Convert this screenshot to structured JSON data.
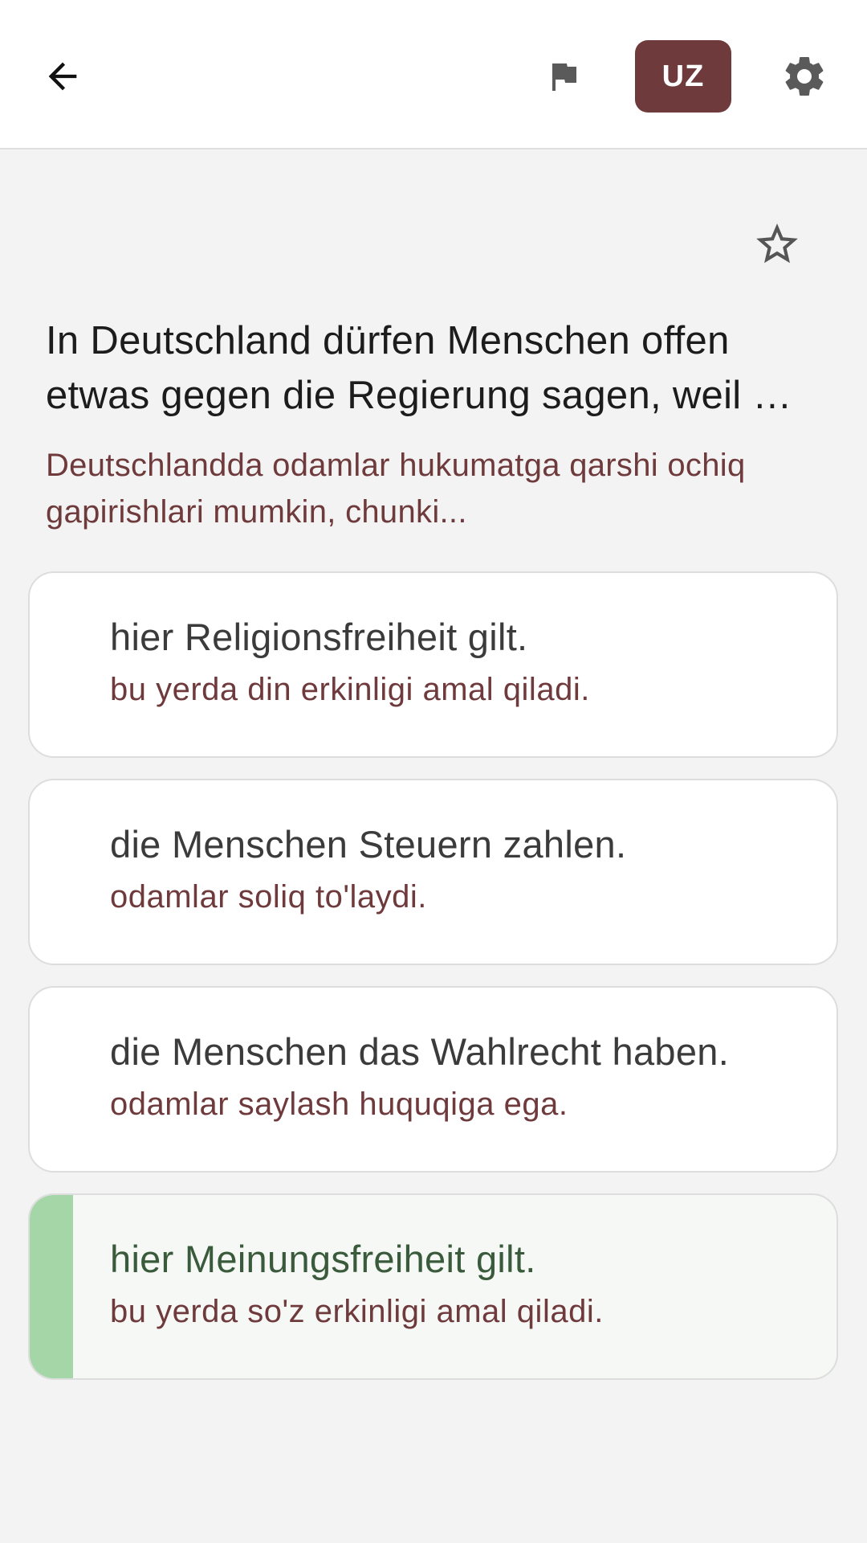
{
  "header": {
    "language_label": "UZ",
    "icons": {
      "back": "arrow-left-icon",
      "flag": "flag-icon",
      "settings": "gear-icon"
    }
  },
  "question": {
    "favorite_icon": "star-outline-icon",
    "text_de": "In Deutschland dürfen Menschen offen etwas gegen die Regierung sagen, weil …",
    "text_uz": "Deutschlandda odamlar hukumatga qarshi ochiq gapirishlari mumkin, chunki..."
  },
  "options": [
    {
      "de": "hier Religionsfreiheit gilt.",
      "uz": "bu yerda din erkinligi amal qiladi.",
      "state": "normal"
    },
    {
      "de": "die Menschen Steuern zahlen.",
      "uz": "odamlar soliq to'laydi.",
      "state": "normal"
    },
    {
      "de": "die Menschen das Wahlrecht haben.",
      "uz": "odamlar saylash huquqiga ega.",
      "state": "normal"
    },
    {
      "de": "hier Meinungsfreiheit gilt.",
      "uz": "bu yerda so'z erkinligi amal qiladi.",
      "state": "correct"
    }
  ],
  "colors": {
    "accent": "#6e3a3c",
    "correct_bar": "#a5d6a7",
    "correct_text": "#3a5a3c",
    "background": "#f3f3f3"
  }
}
